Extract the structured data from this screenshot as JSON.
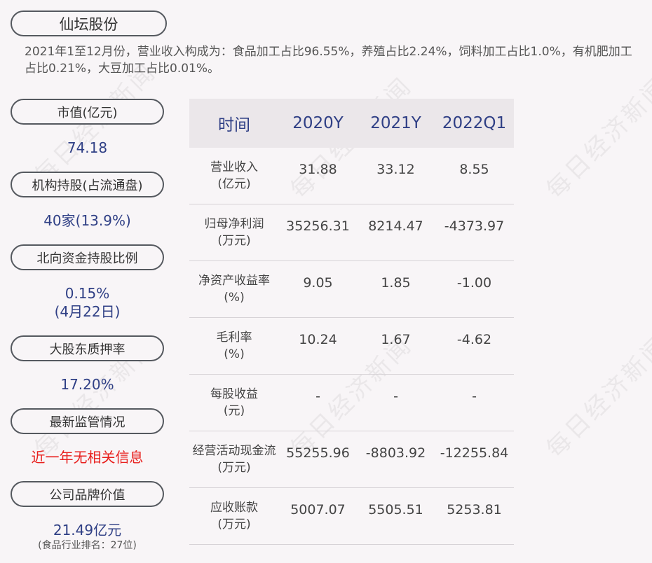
{
  "title": "仙坛股份",
  "summary": "2021年1至12月份，营业收入构成为：食品加工占比96.55%，养殖占比2.24%，饲料加工占比1.0%，有机肥加工占比0.21%，大豆加工占比0.01%。",
  "sidebar": {
    "market_cap": {
      "label": "市值(亿元)",
      "value": "74.18"
    },
    "institutions": {
      "label": "机构持股(占流通盘)",
      "value": "40家(13.9%)"
    },
    "northbound": {
      "label": "北向资金持股比例",
      "value": "0.15%",
      "date": "(4月22日)"
    },
    "pledge": {
      "label": "大股东质押率",
      "value": "17.20%"
    },
    "regulation": {
      "label": "最新监管情况",
      "value": "近一年无相关信息"
    },
    "brand": {
      "label": "公司品牌价值",
      "value": "21.49亿元",
      "note": "(食品行业排名：27位)"
    }
  },
  "table": {
    "headers": [
      "时间",
      "2020Y",
      "2021Y",
      "2022Q1"
    ],
    "rows": [
      {
        "label": "营业收入",
        "unit": "(亿元)",
        "values": [
          "31.88",
          "33.12",
          "8.55"
        ]
      },
      {
        "label": "归母净利润",
        "unit": "(万元)",
        "values": [
          "35256.31",
          "8214.47",
          "-4373.97"
        ]
      },
      {
        "label": "净资产收益率",
        "unit": "(%)",
        "values": [
          "9.05",
          "1.85",
          "-1.00"
        ]
      },
      {
        "label": "毛利率",
        "unit": "(%)",
        "values": [
          "10.24",
          "1.67",
          "-4.62"
        ]
      },
      {
        "label": "每股收益",
        "unit": "(元)",
        "values": [
          "-",
          "-",
          "-"
        ]
      },
      {
        "label": "经营活动现金流",
        "unit": "(万元)",
        "values": [
          "55255.96",
          "-8803.92",
          "-12255.84"
        ]
      },
      {
        "label": "应收账款",
        "unit": "(万元)",
        "values": [
          "5007.07",
          "5505.51",
          "5253.81"
        ]
      }
    ]
  },
  "watermark": "每日经济新闻",
  "colors": {
    "accent": "#2f3f85",
    "alert": "#e8201e",
    "header_bg": "#ebe7ea",
    "bg": "#f8f5f7"
  }
}
